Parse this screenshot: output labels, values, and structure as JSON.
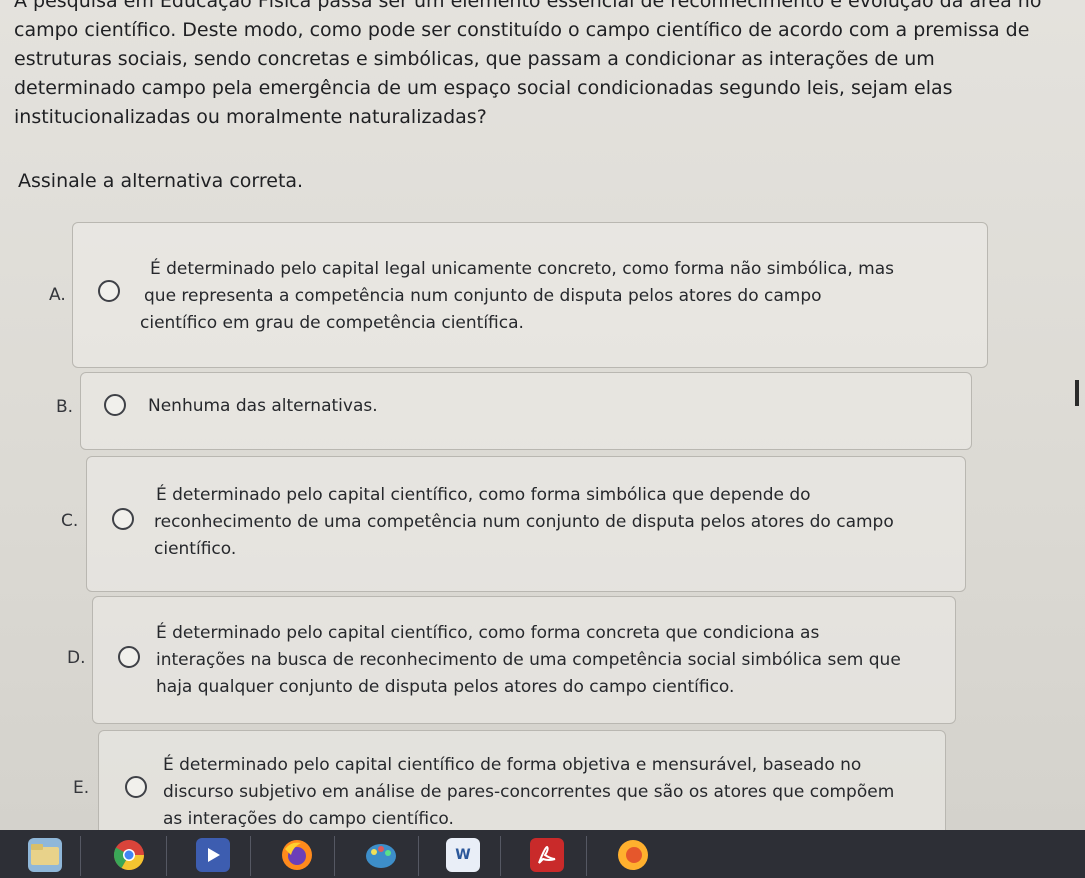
{
  "question": {
    "lines": [
      "A pesquisa em Educação Física passa ser um elemento essencial de reconhecimento e evolução da área no",
      "campo científico. Deste modo, como pode ser constituído o campo científico de acordo com a premissa de",
      "estruturas sociais, sendo concretas e simbólicas, que passam a condicionar as interações de um",
      "determinado campo pela emergência de um espaço social condicionadas segundo leis, sejam elas",
      "institucionalizadas ou moralmente naturalizadas?"
    ],
    "instruction": "Assinale a alternativa correta."
  },
  "options": [
    {
      "letter": "A.",
      "lines": [
        "É determinado pelo capital legal unicamente concreto, como forma não simbólica, mas",
        "que representa a competência num conjunto de disputa pelos atores do campo",
        "científico em grau de competência científica."
      ]
    },
    {
      "letter": "B.",
      "lines": [
        "Nenhuma das alternativas."
      ]
    },
    {
      "letter": "C.",
      "lines": [
        "É determinado pelo capital científico, como forma simbólica que depende do",
        "reconhecimento de uma competência num conjunto de disputa pelos atores do campo",
        "científico."
      ]
    },
    {
      "letter": "D.",
      "lines": [
        "É determinado pelo capital científico, como forma concreta que condiciona as",
        "interações na busca de reconhecimento de uma competência social simbólica sem que",
        "haja qualquer conjunto de disputa pelos atores do campo científico."
      ]
    },
    {
      "letter": "E.",
      "lines": [
        "É determinado pelo capital científico de forma objetiva e mensurável, baseado no",
        "discurso subjetivo em análise de pares-concorrentes que são os atores que compõem",
        "as interações do campo científico."
      ]
    }
  ],
  "taskbar": {
    "icons": [
      "file-manager-icon",
      "chrome-icon",
      "media-player-icon",
      "firefox-icon",
      "paint-icon",
      "word-icon",
      "acrobat-icon",
      "browser-icon"
    ],
    "word_label": "W"
  },
  "colors": {
    "page_bg": "#dcdad4",
    "text": "#1f2023",
    "card_border": "#b9b7b1",
    "taskbar_bg": "#2d2f36"
  }
}
